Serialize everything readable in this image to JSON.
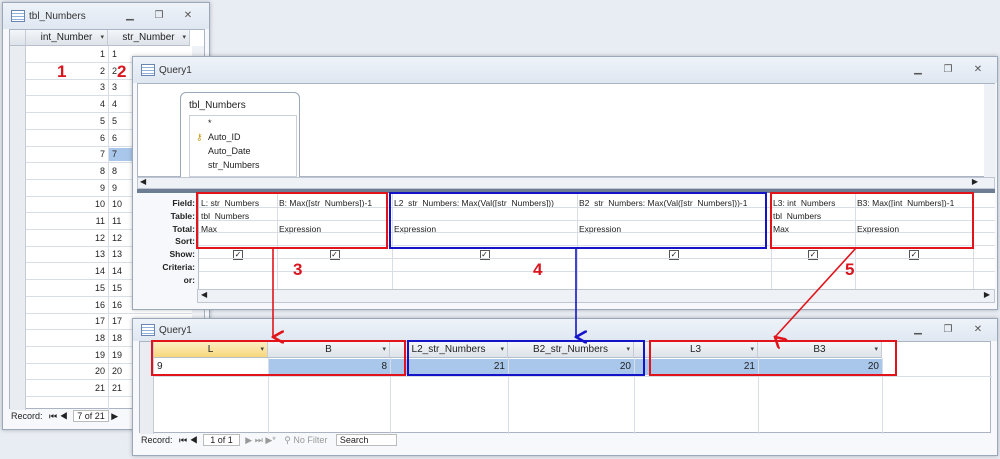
{
  "table_window": {
    "title": "tbl_Numbers",
    "col1": "int_Number",
    "col2": "str_Number",
    "rows": [
      "1",
      "2",
      "3",
      "4",
      "5",
      "6",
      "7",
      "8",
      "9",
      "10",
      "11",
      "12",
      "13",
      "14",
      "15",
      "16",
      "17",
      "18",
      "19",
      "20",
      "21"
    ],
    "record_label": "Record:",
    "record_pos": "7 of 21"
  },
  "query_design": {
    "title": "Query1",
    "table_box": {
      "title": "tbl_Numbers",
      "fields": [
        "*",
        "Auto_ID",
        "Auto_Date",
        "str_Numbers"
      ]
    },
    "row_labels": [
      "Field:",
      "Table:",
      "Total:",
      "Sort:",
      "Show:",
      "Criteria:",
      "or:"
    ],
    "columns": [
      {
        "field": "L: str_Numbers",
        "table": "tbl_Numbers",
        "total": "Max"
      },
      {
        "field": "B: Max([str_Numbers])-1",
        "table": "",
        "total": "Expression"
      },
      {
        "field": "L2_str_Numbers: Max(Val([str_Numbers]))",
        "table": "",
        "total": "Expression"
      },
      {
        "field": "B2_str_Numbers: Max(Val([str_Numbers]))-1",
        "table": "",
        "total": "Expression"
      },
      {
        "field": "L3: int_Numbers",
        "table": "tbl_Numbers",
        "total": "Max"
      },
      {
        "field": "B3: Max([int_Numbers])-1",
        "table": "",
        "total": "Expression"
      }
    ]
  },
  "query_result": {
    "title": "Query1",
    "headers": [
      "L",
      "B",
      "L2_str_Numbers",
      "B2_str_Numbers",
      "L3",
      "B3"
    ],
    "values": [
      "9",
      "8",
      "21",
      "20",
      "21",
      "20"
    ],
    "record_label": "Record:",
    "record_pos": "1 of 1",
    "filter": "No Filter",
    "search": "Search"
  },
  "callouts": [
    "1",
    "2",
    "3",
    "4",
    "5"
  ],
  "colors": {
    "red": "#e2141b",
    "blue": "#1413c8",
    "highlight": "#a9c7ea",
    "selected_cell": "#fce6a0"
  }
}
